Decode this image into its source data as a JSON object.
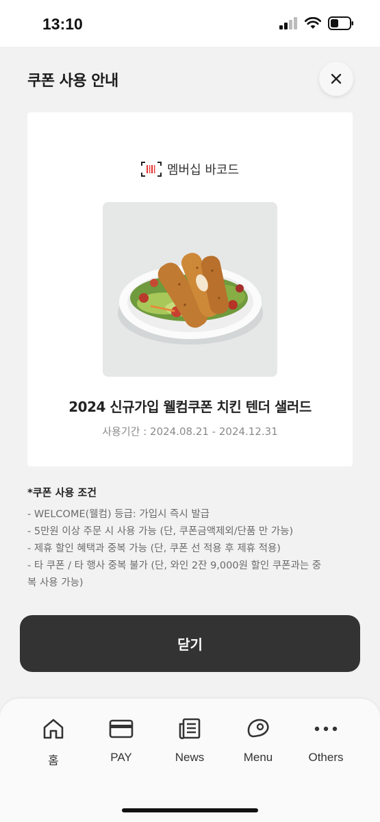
{
  "status_bar": {
    "time": "13:10"
  },
  "header": {
    "title": "쿠폰 사용 안내",
    "close_icon": "close-icon"
  },
  "coupon": {
    "barcode_label": "멤버십 바코드",
    "image_icon": "chicken-tender-salad",
    "title": "2024 신규가입 웰컴쿠폰 치킨 텐더 샐러드",
    "period": "사용기간 : 2024.08.21 - 2024.12.31"
  },
  "conditions": {
    "title": "*쿠폰 사용 조건",
    "items": [
      "- WELCOME(웰컴) 등급: 가입시 즉시 발급",
      "- 5만원 이상 주문 시 사용 가능 (단, 쿠폰금액제외/단품 만 가능)",
      "- 제휴 할인 혜택과 중복 가능 (단, 쿠폰 선 적용 후 제휴 적용)",
      "- 타 쿠폰 / 타 행사 중복 불가 (단, 와인 2잔 9,000원 할인 쿠폰과는 중",
      "복 사용 가능)"
    ]
  },
  "close_button_label": "닫기",
  "tabs": [
    {
      "label": "홈",
      "icon": "home-icon"
    },
    {
      "label": "PAY",
      "icon": "card-icon"
    },
    {
      "label": "News",
      "icon": "news-icon"
    },
    {
      "label": "Menu",
      "icon": "steak-icon"
    },
    {
      "label": "Others",
      "icon": "more-icon"
    }
  ]
}
